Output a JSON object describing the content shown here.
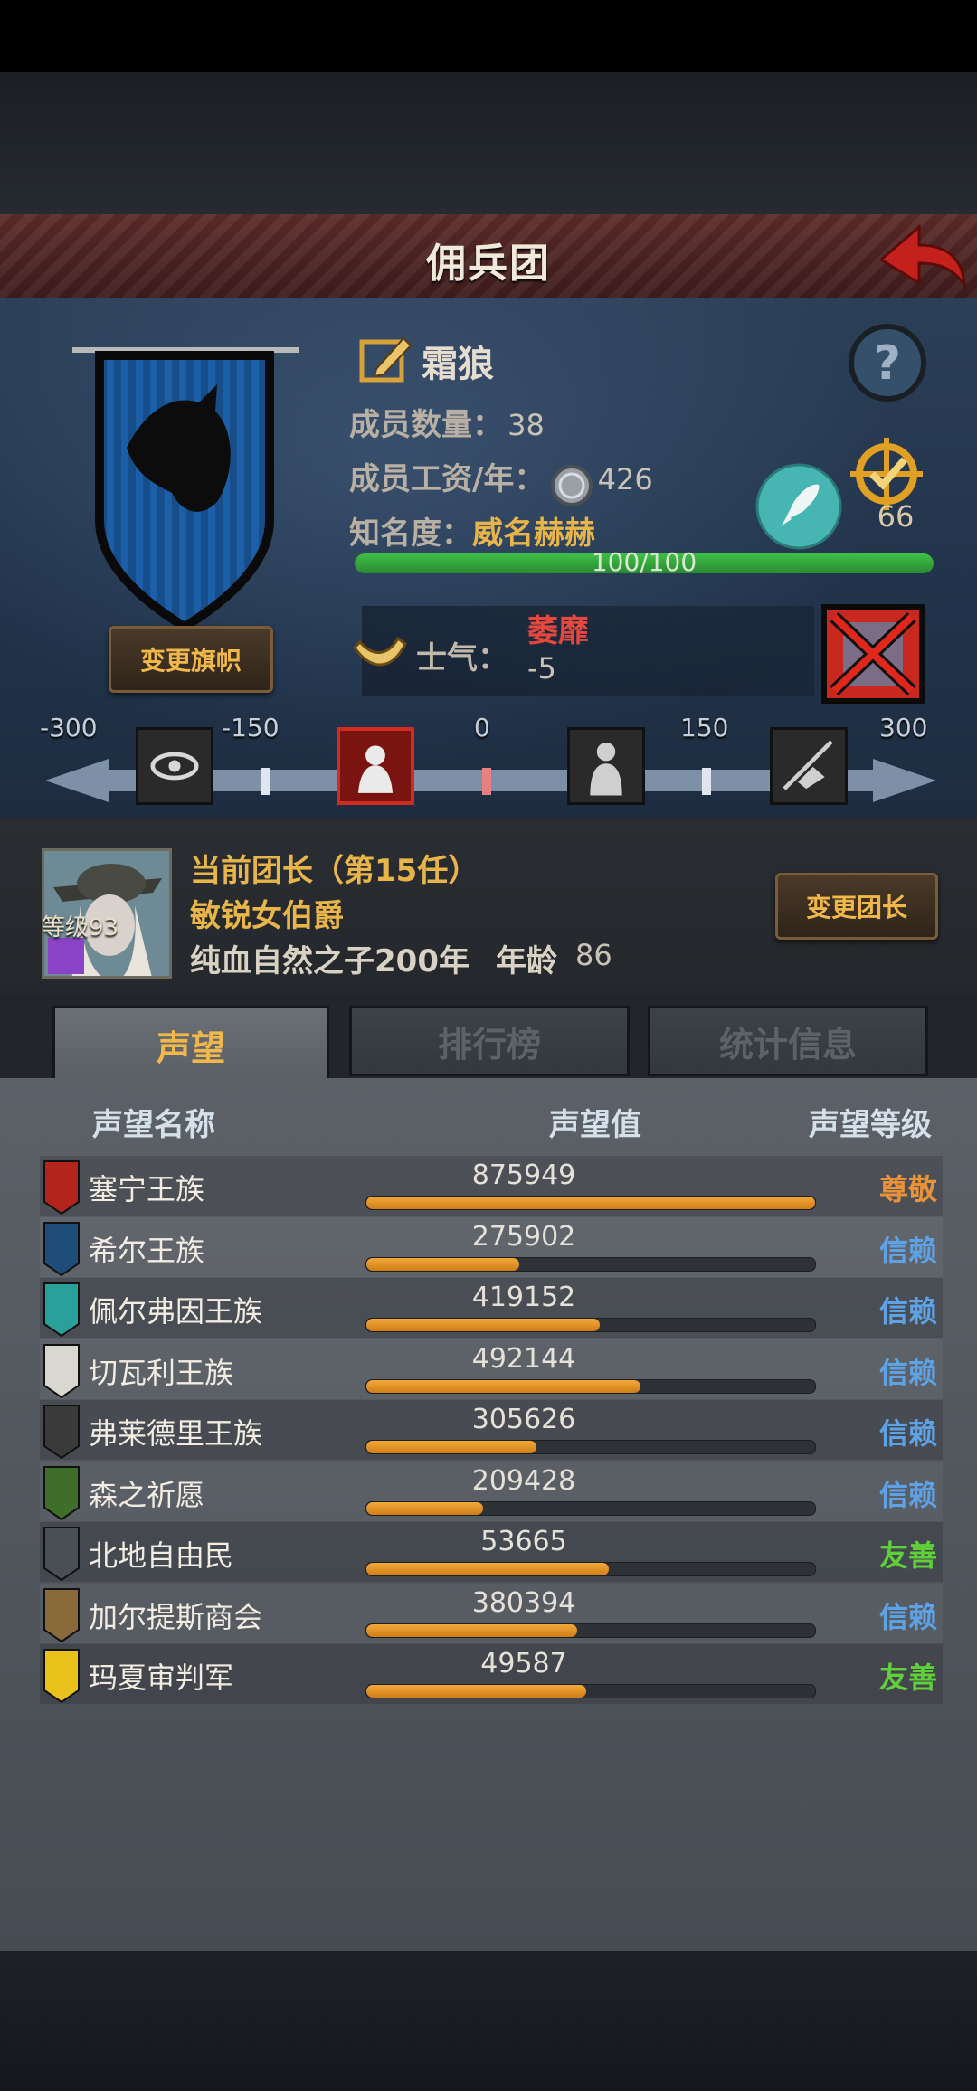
{
  "header": {
    "title": "佣兵团"
  },
  "guild": {
    "change_flag_label": "变更旗帜",
    "name": "霜狼",
    "members_label": "成员数量：",
    "members_value": "38",
    "salary_label": "成员工资/年：",
    "salary_value": "426",
    "fame_label": "知名度：",
    "fame_value": "威名赫赫",
    "fame_progress_text": "100/100",
    "fame_progress": 1.0,
    "target_count": "66",
    "morale_label": "士气：",
    "morale_state": "萎靡",
    "morale_value": "-5"
  },
  "morale_scale": {
    "ticks": [
      "-300",
      "-150",
      "0",
      "150",
      "300"
    ],
    "active_node": 1
  },
  "leader": {
    "title": "当前团长（第15任）",
    "name": "敏锐女伯爵",
    "race": "纯血自然之子200年",
    "age_label": "年龄",
    "age": "86",
    "level": "等级93",
    "change_leader_label": "变更团长"
  },
  "tabs": [
    {
      "label": "声望",
      "active": true
    },
    {
      "label": "排行榜",
      "active": false
    },
    {
      "label": "统计信息",
      "active": false
    }
  ],
  "reputation": {
    "col_name": "声望名称",
    "col_value": "声望值",
    "col_level": "声望等级",
    "rows": [
      {
        "name": "塞宁王族",
        "value": "875949",
        "fill": 1.0,
        "level": "尊敬",
        "level_color": "#e8923a",
        "crest_color": "#b2241c"
      },
      {
        "name": "希尔王族",
        "value": "275902",
        "fill": 0.34,
        "level": "信赖",
        "level_color": "#5ea2e6",
        "crest_color": "#1f4d7a"
      },
      {
        "name": "佩尔弗因王族",
        "value": "419152",
        "fill": 0.52,
        "level": "信赖",
        "level_color": "#5ea2e6",
        "crest_color": "#2aa09a"
      },
      {
        "name": "切瓦利王族",
        "value": "492144",
        "fill": 0.61,
        "level": "信赖",
        "level_color": "#5ea2e6",
        "crest_color": "#d8d8d0"
      },
      {
        "name": "弗莱德里王族",
        "value": "305626",
        "fill": 0.38,
        "level": "信赖",
        "level_color": "#5ea2e6",
        "crest_color": "#3a3a3a"
      },
      {
        "name": "森之祈愿",
        "value": "209428",
        "fill": 0.26,
        "level": "信赖",
        "level_color": "#5ea2e6",
        "crest_color": "#3e6e2a"
      },
      {
        "name": "北地自由民",
        "value": "53665",
        "fill": 0.54,
        "level": "友善",
        "level_color": "#5fcf3a",
        "crest_color": "#4a4f55"
      },
      {
        "name": "加尔提斯商会",
        "value": "380394",
        "fill": 0.47,
        "level": "信赖",
        "level_color": "#5ea2e6",
        "crest_color": "#8a6a3a"
      },
      {
        "name": "玛夏审判军",
        "value": "49587",
        "fill": 0.49,
        "level": "友善",
        "level_color": "#5fcf3a",
        "crest_color": "#e8c21a"
      }
    ]
  }
}
